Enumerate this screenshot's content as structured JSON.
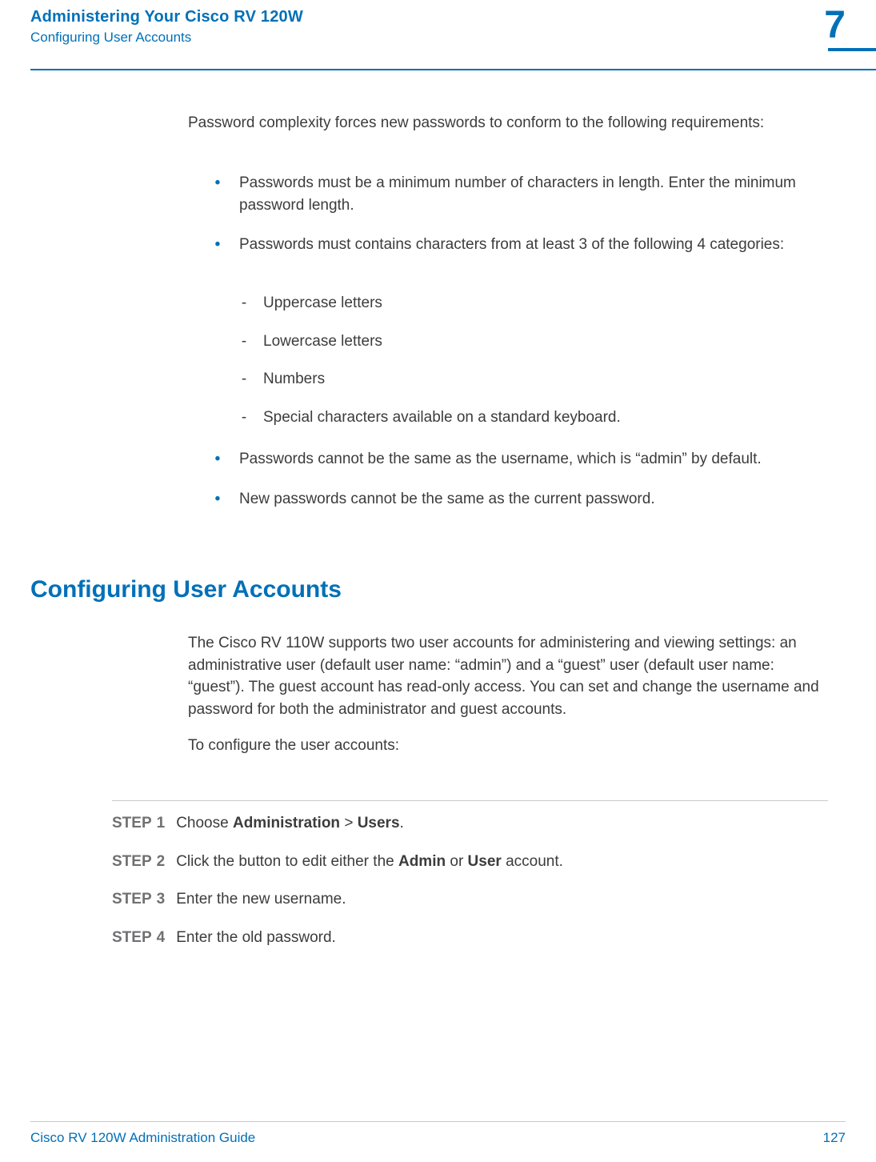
{
  "header": {
    "title": "Administering Your Cisco RV 120W",
    "subtitle": "Configuring User Accounts",
    "chapter_number": "7"
  },
  "intro": {
    "lead": "Password complexity forces new passwords to conform to the following requirements:",
    "bullets": [
      "Passwords must be a minimum number of characters in length. Enter the minimum password length.",
      "Passwords must contains characters from at least 3 of the following 4 categories:"
    ],
    "sub_bullets": [
      "Uppercase letters",
      "Lowercase letters",
      "Numbers",
      "Special characters available on a standard keyboard."
    ],
    "bullets_after": [
      "Passwords cannot be the same as the username, which is “admin” by default.",
      "New passwords cannot be the same as the current password."
    ]
  },
  "section": {
    "heading": "Configuring User Accounts",
    "body1": "The Cisco RV 110W supports two user accounts for administering and viewing settings: an administrative user (default user name: “admin”) and a “guest” user (default user name: “guest”). The guest account has read-only access. You can set and change the username and password for both the administrator and guest accounts.",
    "body2": "To configure the user accounts:"
  },
  "steps": {
    "label": "STEP",
    "items": [
      {
        "num": "1",
        "prefix": "Choose ",
        "bold1": "Administration",
        "mid": " > ",
        "bold2": "Users",
        "suffix": "."
      },
      {
        "num": "2",
        "prefix": "Click the button to edit either the ",
        "bold1": "Admin",
        "mid": " or ",
        "bold2": "User",
        "suffix": " account."
      },
      {
        "num": "3",
        "prefix": "Enter the new username.",
        "bold1": "",
        "mid": "",
        "bold2": "",
        "suffix": ""
      },
      {
        "num": "4",
        "prefix": "Enter the old password.",
        "bold1": "",
        "mid": "",
        "bold2": "",
        "suffix": ""
      }
    ]
  },
  "footer": {
    "left": "Cisco RV 120W Administration Guide",
    "right": "127"
  }
}
